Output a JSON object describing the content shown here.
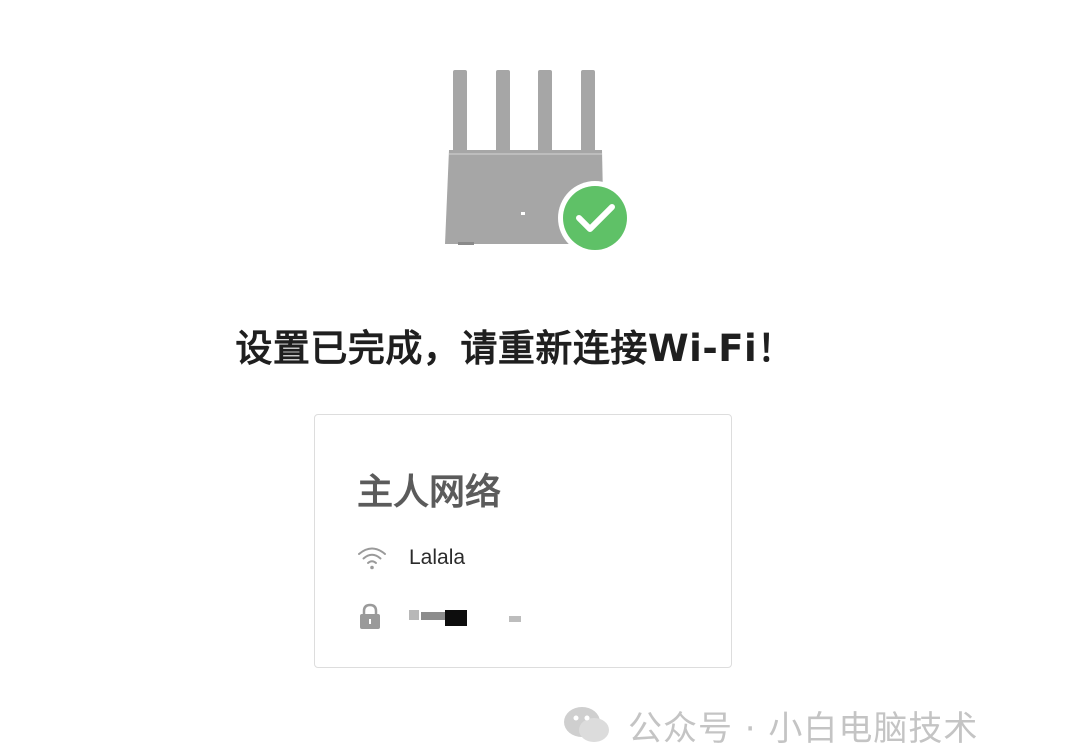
{
  "headline": "设置已完成，请重新连接Wi-Fi！",
  "network": {
    "title": "主人网络",
    "ssid": "Lalala",
    "password": "",
    "ssid_icon": "wifi-icon",
    "password_icon": "lock-icon"
  },
  "watermark": "公众号 · 小白电脑技术",
  "colors": {
    "router": "#a6a6a6",
    "check_circle": "#5fc167",
    "headline": "#1f1f1f",
    "card_title": "#5b5b5b"
  }
}
